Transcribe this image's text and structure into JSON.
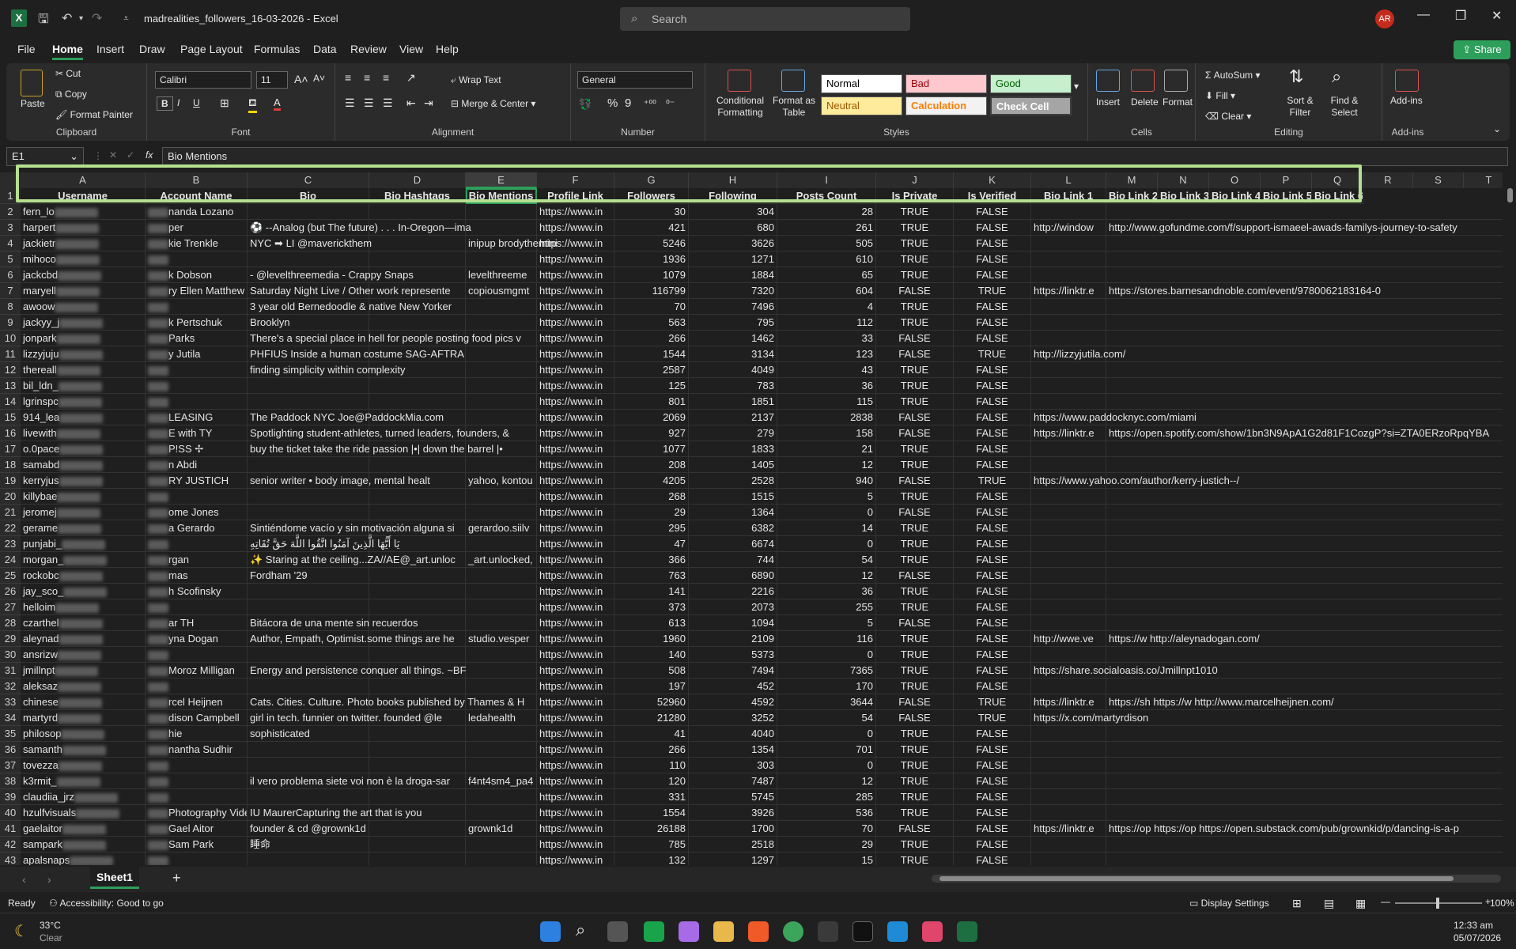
{
  "app": {
    "doc_title": "madrealities_followers_16-03-2026",
    "app_name": "Excel",
    "title_sep": " - ",
    "search_placeholder": "Search",
    "avatar_initials": "AR",
    "logo_letter": "X"
  },
  "menu": [
    "File",
    "Home",
    "Insert",
    "Draw",
    "Page Layout",
    "Formulas",
    "Data",
    "Review",
    "View",
    "Help"
  ],
  "share_label": "Share",
  "ribbon": {
    "clipboard": {
      "paste": "Paste",
      "cut": "Cut",
      "copy": "Copy",
      "format_painter": "Format Painter",
      "label": "Clipboard"
    },
    "font": {
      "name": "Calibri",
      "size": "11",
      "label": "Font",
      "bold": "B",
      "italic": "I",
      "underline": "U"
    },
    "alignment": {
      "wrap": "Wrap Text",
      "merge": "Merge & Center",
      "label": "Alignment"
    },
    "number": {
      "format": "General",
      "label": "Number",
      "percent": "%",
      "comma": "9"
    },
    "styles": {
      "cond": "Conditional Formatting",
      "table": "Format as Table",
      "label": "Styles",
      "normal": "Normal",
      "bad": "Bad",
      "good": "Good",
      "neutral": "Neutral",
      "calculation": "Calculation",
      "check": "Check Cell"
    },
    "cells": {
      "insert": "Insert",
      "delete": "Delete",
      "format": "Format",
      "label": "Cells"
    },
    "editing": {
      "autosum": "AutoSum",
      "fill": "Fill",
      "clear": "Clear",
      "sort": "Sort & Filter",
      "find": "Find & Select",
      "label": "Editing"
    },
    "addins": {
      "addins": "Add-ins",
      "label": "Add-ins"
    }
  },
  "formula": {
    "namebox": "E1",
    "fx": "fx",
    "content": "Bio Mentions"
  },
  "columns": [
    "A",
    "B",
    "C",
    "D",
    "E",
    "F",
    "G",
    "H",
    "I",
    "J",
    "K",
    "L",
    "M",
    "N",
    "O",
    "P",
    "Q",
    "R",
    "S",
    "T"
  ],
  "headers": [
    "Username",
    "Account Name",
    "Bio",
    "Bio Hashtags",
    "Bio Mentions",
    "Profile Link",
    "Followers",
    "Following",
    "Posts Count",
    "Is Private",
    "Is Verified",
    "Bio Link 1",
    "Bio Link 2",
    "Bio Link 3",
    "Bio Link 4",
    "Bio Link 5",
    "Bio Link 6"
  ],
  "rows": [
    {
      "n": "2",
      "a": "fern_lo",
      "b": "nanda Lozano",
      "c": "",
      "d": "",
      "e": "",
      "f": "https://www.in",
      "g": "30",
      "h": "304",
      "i": "28",
      "j": "TRUE",
      "k": "FALSE",
      "l": "",
      "m": ""
    },
    {
      "n": "3",
      "a": "harpert",
      "b": "per",
      "c": "⚽ --Analog (but The future) . . . In-Oregon—ima",
      "d": "",
      "e": "",
      "f": "https://www.in",
      "g": "421",
      "h": "680",
      "i": "261",
      "j": "TRUE",
      "k": "FALSE",
      "l": "http://window",
      "m": "http://www.gofundme.com/f/support-ismaeel-awads-familys-journey-to-safety"
    },
    {
      "n": "4",
      "a": "jackietr",
      "b": "kie Trenkle",
      "c": "NYC ➡ LI @maverickthem",
      "d": "",
      "e": "inipup brodythemini",
      "f": "https://www.in",
      "g": "5246",
      "h": "3626",
      "i": "505",
      "j": "TRUE",
      "k": "FALSE",
      "l": "",
      "m": ""
    },
    {
      "n": "5",
      "a": "mihoco",
      "b": "",
      "c": "",
      "d": "",
      "e": "",
      "f": "https://www.in",
      "g": "1936",
      "h": "1271",
      "i": "610",
      "j": "TRUE",
      "k": "FALSE",
      "l": "",
      "m": ""
    },
    {
      "n": "6",
      "a": "jackcbd",
      "b": "k Dobson",
      "c": "- @levelthreemedia - Crappy Snaps",
      "d": "",
      "e": "levelthreeme",
      "f": "https://www.in",
      "g": "1079",
      "h": "1884",
      "i": "65",
      "j": "TRUE",
      "k": "FALSE",
      "l": "",
      "m": ""
    },
    {
      "n": "7",
      "a": "maryell",
      "b": "ry Ellen Matthew",
      "c": "Saturday Night Live / Other work represente",
      "d": "",
      "e": "copiousmgmt",
      "f": "https://www.in",
      "g": "116799",
      "h": "7320",
      "i": "604",
      "j": "FALSE",
      "k": "TRUE",
      "l": "https://linktr.e",
      "m": "https://stores.barnesandnoble.com/event/9780062183164-0"
    },
    {
      "n": "8",
      "a": "awoow",
      "b": "",
      "c": "3 year old Bernedoodle & native New Yorker",
      "d": "",
      "e": "",
      "f": "https://www.in",
      "g": "70",
      "h": "7496",
      "i": "4",
      "j": "TRUE",
      "k": "FALSE",
      "l": "",
      "m": ""
    },
    {
      "n": "9",
      "a": "jackyy_j",
      "b": "k Pertschuk",
      "c": "Brooklyn",
      "d": "",
      "e": "",
      "f": "https://www.in",
      "g": "563",
      "h": "795",
      "i": "112",
      "j": "TRUE",
      "k": "FALSE",
      "l": "",
      "m": ""
    },
    {
      "n": "10",
      "a": "jonpark",
      "b": "Parks",
      "c": "There's a special place in hell for people posting food pics v",
      "d": "",
      "e": "",
      "f": "https://www.in",
      "g": "266",
      "h": "1462",
      "i": "33",
      "j": "FALSE",
      "k": "FALSE",
      "l": "",
      "m": ""
    },
    {
      "n": "11",
      "a": "lizzyjuju",
      "b": "y Jutila",
      "c": "PHFIUS Inside a human costume SAG-AFTRA",
      "d": "",
      "e": "",
      "f": "https://www.in",
      "g": "1544",
      "h": "3134",
      "i": "123",
      "j": "FALSE",
      "k": "TRUE",
      "l": "http://lizzyjutila.com/",
      "m": ""
    },
    {
      "n": "12",
      "a": "thereall",
      "b": "",
      "c": "finding simplicity within complexity",
      "d": "",
      "e": "",
      "f": "https://www.in",
      "g": "2587",
      "h": "4049",
      "i": "43",
      "j": "TRUE",
      "k": "FALSE",
      "l": "",
      "m": ""
    },
    {
      "n": "13",
      "a": "bil_ldn_",
      "b": "",
      "c": "",
      "d": "",
      "e": "",
      "f": "https://www.in",
      "g": "125",
      "h": "783",
      "i": "36",
      "j": "TRUE",
      "k": "FALSE",
      "l": "",
      "m": ""
    },
    {
      "n": "14",
      "a": "lgrinspc",
      "b": "",
      "c": "",
      "d": "",
      "e": "",
      "f": "https://www.in",
      "g": "801",
      "h": "1851",
      "i": "115",
      "j": "TRUE",
      "k": "FALSE",
      "l": "",
      "m": ""
    },
    {
      "n": "15",
      "a": "914_lea",
      "b": "LEASING",
      "c": "The Paddock NYC Joe@PaddockMia.com",
      "d": "",
      "e": "",
      "f": "https://www.in",
      "g": "2069",
      "h": "2137",
      "i": "2838",
      "j": "FALSE",
      "k": "FALSE",
      "l": "https://www.paddocknyc.com/miami",
      "m": ""
    },
    {
      "n": "16",
      "a": "livewith",
      "b": "E with TY",
      "c": "Spotlighting student-athletes, turned leaders, founders, &",
      "d": "",
      "e": "",
      "f": "https://www.in",
      "g": "927",
      "h": "279",
      "i": "158",
      "j": "FALSE",
      "k": "FALSE",
      "l": "https://linktr.e",
      "m": "https://open.spotify.com/show/1bn3N9ApA1G2d81F1CozgP?si=ZTA0ERzoRpqYBA"
    },
    {
      "n": "17",
      "a": "o.0pace",
      "b": "P!SS ✢",
      "c": "buy the ticket take the ride passion |•| down the barrel |•",
      "d": "",
      "e": "",
      "f": "https://www.in",
      "g": "1077",
      "h": "1833",
      "i": "21",
      "j": "TRUE",
      "k": "FALSE",
      "l": "",
      "m": ""
    },
    {
      "n": "18",
      "a": "samabd",
      "b": "n Abdi",
      "c": "",
      "d": "",
      "e": "",
      "f": "https://www.in",
      "g": "208",
      "h": "1405",
      "i": "12",
      "j": "TRUE",
      "k": "FALSE",
      "l": "",
      "m": ""
    },
    {
      "n": "19",
      "a": "kerryjus",
      "b": "RY JUSTICH",
      "c": "senior writer • body image, mental healt",
      "d": "",
      "e": "yahoo, kontou",
      "f": "https://www.in",
      "g": "4205",
      "h": "2528",
      "i": "940",
      "j": "FALSE",
      "k": "TRUE",
      "l": "https://www.yahoo.com/author/kerry-justich--/",
      "m": ""
    },
    {
      "n": "20",
      "a": "killybae",
      "b": "",
      "c": "",
      "d": "",
      "e": "",
      "f": "https://www.in",
      "g": "268",
      "h": "1515",
      "i": "5",
      "j": "TRUE",
      "k": "FALSE",
      "l": "",
      "m": ""
    },
    {
      "n": "21",
      "a": "jeromej",
      "b": "ome Jones",
      "c": "",
      "d": "",
      "e": "",
      "f": "https://www.in",
      "g": "29",
      "h": "1364",
      "i": "0",
      "j": "FALSE",
      "k": "FALSE",
      "l": "",
      "m": ""
    },
    {
      "n": "22",
      "a": "gerame",
      "b": "a Gerardo",
      "c": "Sintiéndome vacío y sin motivación alguna si",
      "d": "",
      "e": "gerardoo.siilv",
      "f": "https://www.in",
      "g": "295",
      "h": "6382",
      "i": "14",
      "j": "TRUE",
      "k": "FALSE",
      "l": "",
      "m": ""
    },
    {
      "n": "23",
      "a": "punjabi_",
      "b": "",
      "c": "يَا أَيُّهَا الَّذِينَ آمَنُوا اتَّقُوا اللَّهَ حَقَّ تُقَاتِهِ",
      "d": "",
      "e": "",
      "f": "https://www.in",
      "g": "47",
      "h": "6674",
      "i": "0",
      "j": "TRUE",
      "k": "FALSE",
      "l": "",
      "m": ""
    },
    {
      "n": "24",
      "a": "morgan_",
      "b": "rgan",
      "c": "✨ Staring at the ceiling...ZA//AE@_art.unloc",
      "d": "",
      "e": "_art.unlocked,",
      "f": "https://www.in",
      "g": "366",
      "h": "744",
      "i": "54",
      "j": "TRUE",
      "k": "FALSE",
      "l": "",
      "m": ""
    },
    {
      "n": "25",
      "a": "rockobc",
      "b": "mas",
      "c": "Fordham '29",
      "d": "",
      "e": "",
      "f": "https://www.in",
      "g": "763",
      "h": "6890",
      "i": "12",
      "j": "FALSE",
      "k": "FALSE",
      "l": "",
      "m": ""
    },
    {
      "n": "26",
      "a": "jay_sco_",
      "b": "h Scofinsky",
      "c": "",
      "d": "",
      "e": "",
      "f": "https://www.in",
      "g": "141",
      "h": "2216",
      "i": "36",
      "j": "TRUE",
      "k": "FALSE",
      "l": "",
      "m": ""
    },
    {
      "n": "27",
      "a": "helloim",
      "b": "",
      "c": "",
      "d": "",
      "e": "",
      "f": "https://www.in",
      "g": "373",
      "h": "2073",
      "i": "255",
      "j": "TRUE",
      "k": "FALSE",
      "l": "",
      "m": ""
    },
    {
      "n": "28",
      "a": "czarthel",
      "b": "ar TH",
      "c": "Bitácora de una mente sin recuerdos",
      "d": "",
      "e": "",
      "f": "https://www.in",
      "g": "613",
      "h": "1094",
      "i": "5",
      "j": "FALSE",
      "k": "FALSE",
      "l": "",
      "m": ""
    },
    {
      "n": "29",
      "a": "aleynad",
      "b": "yna Dogan",
      "c": "Author, Empath, Optimist.some things are he",
      "d": "",
      "e": "studio.vesper",
      "f": "https://www.in",
      "g": "1960",
      "h": "2109",
      "i": "116",
      "j": "TRUE",
      "k": "FALSE",
      "l": "http://wwe.ve",
      "m": "https://w http://aleynadogan.com/"
    },
    {
      "n": "30",
      "a": "ansrizw",
      "b": "",
      "c": "",
      "d": "",
      "e": "",
      "f": "https://www.in",
      "g": "140",
      "h": "5373",
      "i": "0",
      "j": "TRUE",
      "k": "FALSE",
      "l": "",
      "m": ""
    },
    {
      "n": "31",
      "a": "jmillnpt",
      "b": "Moroz Milligan",
      "c": "Energy and persistence conquer all things. ~BF",
      "d": "",
      "e": "",
      "f": "https://www.in",
      "g": "508",
      "h": "7494",
      "i": "7365",
      "j": "TRUE",
      "k": "FALSE",
      "l": "https://share.socialoasis.co/Jmillnpt1010",
      "m": ""
    },
    {
      "n": "32",
      "a": "aleksaz",
      "b": "",
      "c": "",
      "d": "",
      "e": "",
      "f": "https://www.in",
      "g": "197",
      "h": "452",
      "i": "170",
      "j": "TRUE",
      "k": "FALSE",
      "l": "",
      "m": ""
    },
    {
      "n": "33",
      "a": "chinese",
      "b": "rcel Heijnen",
      "c": "Cats. Cities. Culture. Photo books published by Thames & H",
      "d": "",
      "e": "",
      "f": "https://www.in",
      "g": "52960",
      "h": "4592",
      "i": "3644",
      "j": "FALSE",
      "k": "TRUE",
      "l": "https://linktr.e",
      "m": "https://sh https://w http://www.marcelheijnen.com/"
    },
    {
      "n": "34",
      "a": "martyrd",
      "b": "dison Campbell",
      "c": "girl in tech. funnier on twitter. founded @le",
      "d": "",
      "e": "ledahealth",
      "f": "https://www.in",
      "g": "21280",
      "h": "3252",
      "i": "54",
      "j": "FALSE",
      "k": "TRUE",
      "l": "https://x.com/martyrdison",
      "m": ""
    },
    {
      "n": "35",
      "a": "philosop",
      "b": "hie",
      "c": "sophisticated",
      "d": "",
      "e": "",
      "f": "https://www.in",
      "g": "41",
      "h": "4040",
      "i": "0",
      "j": "TRUE",
      "k": "FALSE",
      "l": "",
      "m": ""
    },
    {
      "n": "36",
      "a": "samanth",
      "b": "nantha Sudhir",
      "c": "",
      "d": "",
      "e": "",
      "f": "https://www.in",
      "g": "266",
      "h": "1354",
      "i": "701",
      "j": "TRUE",
      "k": "FALSE",
      "l": "",
      "m": ""
    },
    {
      "n": "37",
      "a": "tovezza",
      "b": "",
      "c": "",
      "d": "",
      "e": "",
      "f": "https://www.in",
      "g": "110",
      "h": "303",
      "i": "0",
      "j": "TRUE",
      "k": "FALSE",
      "l": "",
      "m": ""
    },
    {
      "n": "38",
      "a": "k3rmit_",
      "b": "",
      "c": "il vero problema siete voi non è la droga-sar",
      "d": "",
      "e": "f4nt4sm4_pa4",
      "f": "https://www.in",
      "g": "120",
      "h": "7487",
      "i": "12",
      "j": "TRUE",
      "k": "FALSE",
      "l": "",
      "m": ""
    },
    {
      "n": "39",
      "a": "claudiia_jrz",
      "b": "",
      "c": "",
      "d": "",
      "e": "",
      "f": "https://www.in",
      "g": "331",
      "h": "5745",
      "i": "285",
      "j": "TRUE",
      "k": "FALSE",
      "l": "",
      "m": ""
    },
    {
      "n": "40",
      "a": "hzulfvisuals",
      "b": "Photography Videog",
      "c": "IU MaurerCapturing the art that is you",
      "d": "",
      "e": "",
      "f": "https://www.in",
      "g": "1554",
      "h": "3926",
      "i": "536",
      "j": "TRUE",
      "k": "FALSE",
      "l": "",
      "m": ""
    },
    {
      "n": "41",
      "a": "gaelaitor",
      "b": "Gael Aitor",
      "c": "founder & cd @grownk1d",
      "d": "",
      "e": "grownk1d",
      "f": "https://www.in",
      "g": "26188",
      "h": "1700",
      "i": "70",
      "j": "FALSE",
      "k": "FALSE",
      "l": "https://linktr.e",
      "m": "https://op https://op https://open.substack.com/pub/grownkid/p/dancing-is-a-p"
    },
    {
      "n": "42",
      "a": "sampark",
      "b": "Sam Park",
      "c": "睡命",
      "d": "",
      "e": "",
      "f": "https://www.in",
      "g": "785",
      "h": "2518",
      "i": "29",
      "j": "TRUE",
      "k": "FALSE",
      "l": "",
      "m": ""
    },
    {
      "n": "43",
      "a": "apalsnaps",
      "b": "",
      "c": "",
      "d": "",
      "e": "",
      "f": "https://www.in",
      "g": "132",
      "h": "1297",
      "i": "15",
      "j": "TRUE",
      "k": "FALSE",
      "l": "",
      "m": ""
    }
  ],
  "sheet": {
    "tab": "Sheet1",
    "add": "+"
  },
  "status": {
    "ready": "Ready",
    "access": "Accessibility: Good to go",
    "display": "Display Settings",
    "zoom": "100%"
  },
  "taskbar": {
    "temp": "33°C",
    "weather": "Clear",
    "time": "12:33 am",
    "date": "05/07/2026"
  }
}
